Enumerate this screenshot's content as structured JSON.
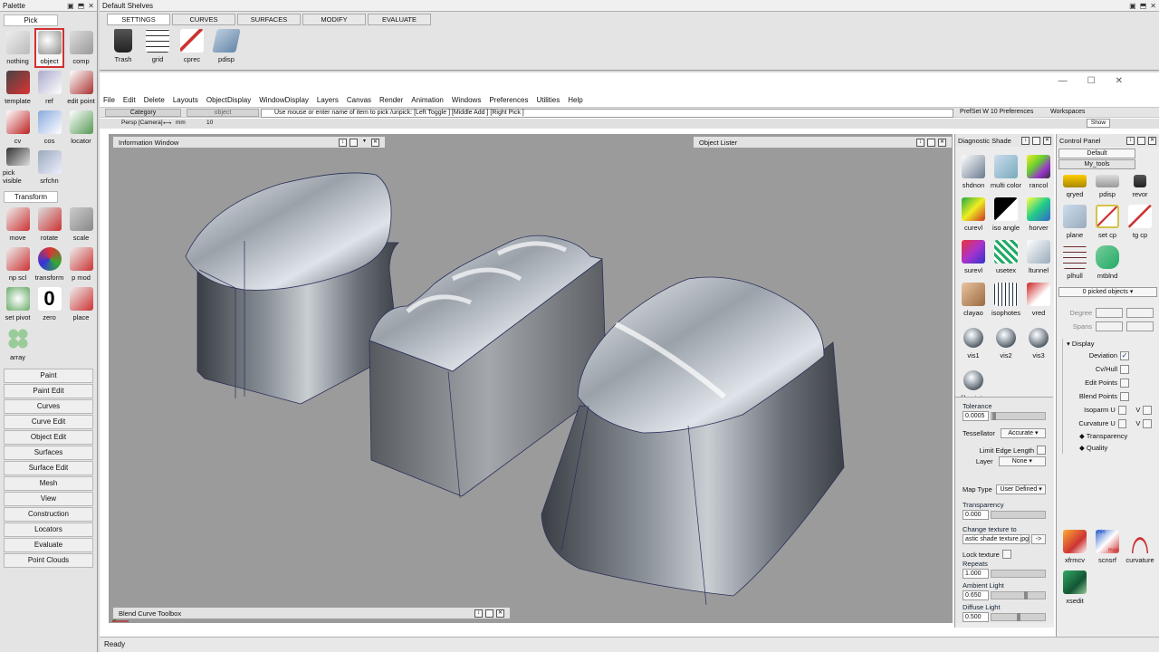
{
  "palette": {
    "title": "Palette",
    "pick_section": "Pick",
    "pick_tools": [
      "nothing",
      "object",
      "comp",
      "template",
      "ref",
      "edit point",
      "cv",
      "cos",
      "locator",
      "pick visible",
      "srfchn"
    ],
    "transform_section": "Transform",
    "transform_tools": [
      "move",
      "rotate",
      "scale",
      "np scl",
      "transform",
      "p mod",
      "set pivot",
      "zero",
      "place",
      "array"
    ],
    "categories": [
      "Paint",
      "Paint Edit",
      "Curves",
      "Curve Edit",
      "Object Edit",
      "Surfaces",
      "Surface Edit",
      "Mesh",
      "View",
      "Construction",
      "Locators",
      "Evaluate",
      "Point Clouds"
    ]
  },
  "shelves": {
    "title": "Default Shelves",
    "tabs": [
      "SETTINGS",
      "CURVES",
      "SURFACES",
      "MODIFY",
      "EVALUATE"
    ],
    "tools": [
      "Trash",
      "grid",
      "cprec",
      "pdisp"
    ]
  },
  "menu": [
    "File",
    "Edit",
    "Delete",
    "Layouts",
    "ObjectDisplay",
    "WindowDisplay",
    "Layers",
    "Canvas",
    "Render",
    "Animation",
    "Windows",
    "Preferences",
    "Utilities",
    "Help"
  ],
  "toolbar": {
    "category": "Category",
    "object": "object",
    "prompt": "Use mouse or enter name of item to pick /unpick: [Left Toggle ] [Middle Add ] [Right Pick ]",
    "prefset": "PrefSet W 10 Preferences",
    "workspaces": "Workspaces",
    "show": "Show",
    "persp": "Persp [Camera]",
    "units": "mm",
    "num": "10"
  },
  "viewport": {
    "info_window": "Information Window",
    "object_lister": "Object Lister",
    "blend_toolbox": "Blend Curve Toolbox"
  },
  "diagnostic": {
    "title": "Diagnostic Shade",
    "tools": [
      "shdnon",
      "multi color",
      "rancol",
      "curevl",
      "iso angle",
      "horver",
      "surevl",
      "usetex",
      "ltunnel",
      "clayao",
      "isophotes",
      "vred",
      "vis1",
      "vis2",
      "vis3",
      "file state"
    ],
    "tolerance_label": "Tolerance",
    "tolerance": "0.0005",
    "tessellator_label": "Tessellator",
    "tessellator": "Accurate",
    "limit_edge": "Limit Edge Length",
    "layer_label": "Layer",
    "layer": "None",
    "map_type_label": "Map Type",
    "map_type": "User Defined",
    "transparency_label": "Transparency",
    "transparency": "0.000",
    "change_texture": "Change texture to",
    "texture_file": "astic shade texture.jpg",
    "texture_btn": "->",
    "lock_texture": "Lock texture",
    "repeats_label": "Repeats",
    "repeats": "1.000",
    "ambient_label": "Ambient Light",
    "ambient": "0.650",
    "diffuse_label": "Diffuse Light",
    "diffuse": "0.500",
    "tolerance_fill": 0.05,
    "ambient_fill": 0.65,
    "diffuse_fill": 0.5
  },
  "control_panel": {
    "title": "Control Panel",
    "preset": "Default",
    "tools_set": "My_tools",
    "tools": [
      "qryed",
      "pdisp",
      "revor",
      "plane",
      "set cp",
      "tg cp",
      "plhull",
      "mtblnd"
    ],
    "picked": "0 picked objects",
    "degree": "Degree",
    "spans": "Spans",
    "display": "Display",
    "display_rows": [
      "Deviation",
      "Cv/Hull",
      "Edit Points",
      "Blend Points",
      "Isoparm U",
      "Curvature U"
    ],
    "v_label": "V",
    "transparency": "Transparency",
    "quality": "Quality",
    "bottom_tools": [
      "xfrmcv",
      "scnsrf",
      "curvature",
      "xsedit"
    ],
    "scnsrf_min": "min",
    "scnsrf_max": "max"
  },
  "status": "Ready"
}
